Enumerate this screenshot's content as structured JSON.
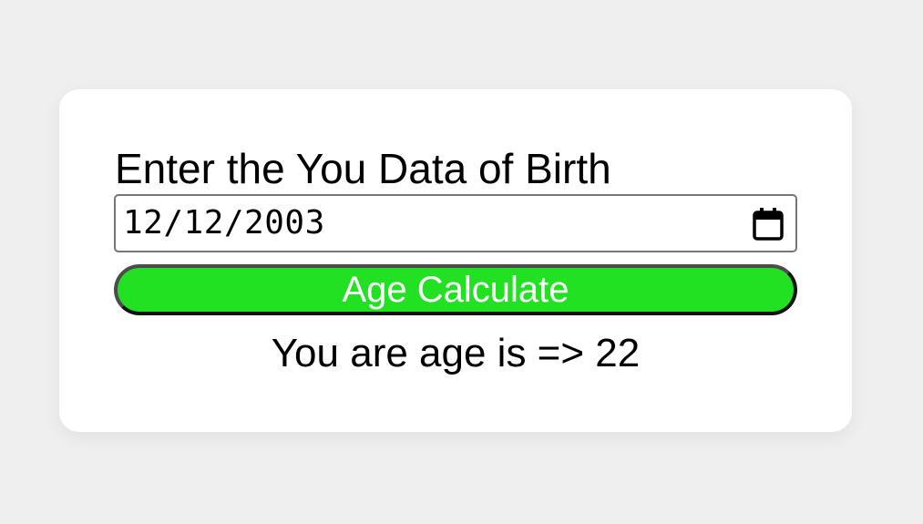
{
  "form": {
    "label": "Enter the You Data of Birth",
    "date_value": "12/12/2003",
    "calendar_icon": "calendar-icon",
    "button_label": "Age Calculate",
    "result_text": "You are age is => 22"
  },
  "colors": {
    "background": "#efefef",
    "card": "#ffffff",
    "button": "#22e022",
    "button_text": "#ffffff"
  }
}
